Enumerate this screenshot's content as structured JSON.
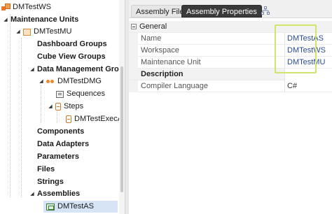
{
  "tree": {
    "root": "DMTestWS",
    "maintenance_units": "Maintenance Units",
    "mu": "DMTestMU",
    "dashboard_groups": "Dashboard Groups",
    "cube_view_groups": "Cube View Groups",
    "dm_groups": "Data Management Groups",
    "dmg": "DMTestDMG",
    "sequences": "Sequences",
    "steps": "Steps",
    "step_item": "DMTestExecASE",
    "components": "Components",
    "data_adapters": "Data Adapters",
    "parameters": "Parameters",
    "files": "Files",
    "strings": "Strings",
    "assemblies": "Assemblies",
    "assembly_item": "DMTestAS"
  },
  "tabs": {
    "files": "Assembly Files",
    "properties": "Assembly Properties",
    "icon": "sitemap-icon"
  },
  "properties": {
    "category": "General",
    "rows": [
      {
        "name": "Name",
        "value": "DMTestAS"
      },
      {
        "name": "Workspace",
        "value": "DMTestWS"
      },
      {
        "name": "Maintenance Unit",
        "value": "DMTestMU"
      }
    ],
    "subcategory": "Description",
    "compiler_label": "Compiler Language",
    "compiler_value": "C#"
  },
  "colors": {
    "highlight": "#d4e36a",
    "active_tab": "#3a3a3a",
    "selection": "#d6e4f5"
  }
}
